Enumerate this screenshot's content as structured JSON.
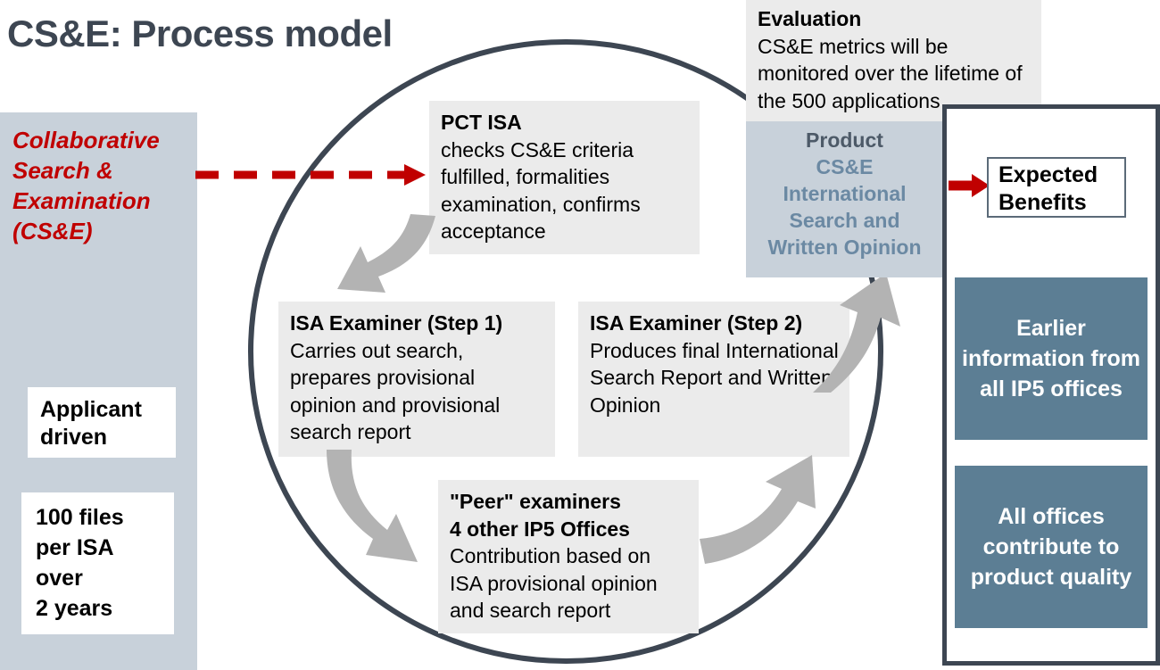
{
  "title": "CS&E: Process model",
  "colors": {
    "title": "#3d4652",
    "accent_red": "#c00000",
    "panel_bg": "#c8d1da",
    "box_bg": "#ebebeb",
    "benefit_bg": "#5c7e94",
    "circle_stroke": "#3d4652",
    "arrow_gray": "#b3b3b3",
    "product_heading": "#4d5a68",
    "product_body": "#6b89a3"
  },
  "left_panel": {
    "heading_lines": [
      "Collaborative",
      "Search &",
      "Examination",
      "(CS&E)"
    ],
    "boxes": [
      {
        "name": "applicant-driven",
        "lines": [
          "Applicant",
          "driven"
        ]
      },
      {
        "name": "files-per-isa",
        "lines": [
          "100 files",
          "per ISA",
          "over",
          "2 years"
        ]
      }
    ]
  },
  "process": {
    "entry_arrow_style": "dashed-red",
    "steps": [
      {
        "id": "pct-isa",
        "heading": "PCT ISA",
        "body": "checks CS&E criteria fulfilled, formalities examination, confirms acceptance"
      },
      {
        "id": "isa-examiner-step-1",
        "heading": "ISA Examiner (Step 1)",
        "body": "Carries out search, prepares provisional opinion and provisional search report"
      },
      {
        "id": "isa-examiner-step-2",
        "heading": "ISA Examiner (Step 2)",
        "body": "Produces final International Search Report and Written Opinion"
      },
      {
        "id": "peer-examiners",
        "heading": "\"Peer\" examiners\n4 other IP5 Offices",
        "heading_line_1": "\"Peer\" examiners",
        "heading_line_2": "4 other IP5 Offices",
        "body": "Contribution based on ISA provisional opinion and search report"
      }
    ]
  },
  "evaluation": {
    "heading": "Evaluation",
    "body": "CS&E metrics will be monitored over the lifetime of the 500 applications"
  },
  "product": {
    "heading": "Product",
    "body_lines": [
      "CS&E",
      "International",
      "Search and",
      "Written Opinion"
    ]
  },
  "benefits": {
    "header_box": {
      "line_1": "Expected",
      "line_2": "Benefits"
    },
    "items": [
      {
        "id": "earlier-information",
        "text": "Earlier information from all IP5 offices"
      },
      {
        "id": "product-quality",
        "text": "All offices contribute to product quality"
      }
    ]
  }
}
